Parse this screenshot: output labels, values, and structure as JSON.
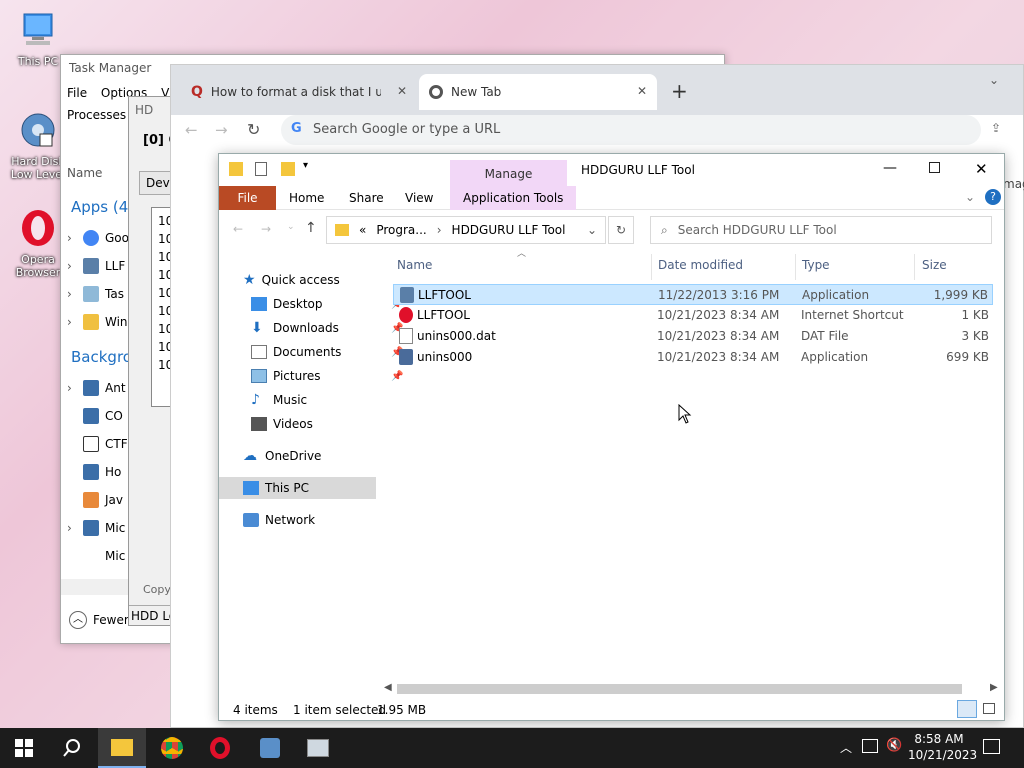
{
  "desktop": {
    "icons": [
      {
        "label": "This PC"
      },
      {
        "label": "Hard Disk Low Level"
      },
      {
        "label": "Opera Browser"
      }
    ]
  },
  "taskmgr": {
    "title": "Task Manager",
    "menu": [
      "File",
      "Options",
      "Vie"
    ],
    "tab": "Processes",
    "column": "Name",
    "apps_group": "Apps (4)",
    "apps": [
      "Goo",
      "LLF",
      "Tas",
      "Win"
    ],
    "bg_group": "Backgro",
    "bg": [
      "Ant",
      "CO",
      "CTF",
      "Ho",
      "Jav",
      "Mic",
      "Mic"
    ],
    "fewer": "Fewer"
  },
  "hddwin": {
    "title": "HD",
    "heading": "[0]  C",
    "dev": "Dev",
    "list": [
      "10",
      "10",
      "10",
      "10",
      "10",
      "10",
      "10",
      "10",
      "10"
    ],
    "copy": "Copy",
    "status": "HDD Lo"
  },
  "chrome": {
    "tabs": [
      {
        "label": "How to format a disk that I usec"
      },
      {
        "label": "New Tab"
      }
    ],
    "omnibox_placeholder": "Search Google or type a URL",
    "side_text": "mag"
  },
  "explorer": {
    "title": "HDDGURU LLF Tool",
    "manage": "Manage",
    "ribbon_tabs": [
      "File",
      "Home",
      "Share",
      "View",
      "Application Tools"
    ],
    "address": {
      "prefix": "«",
      "parts": [
        "Progra...",
        "HDDGURU LLF Tool"
      ]
    },
    "search_placeholder": "Search HDDGURU LLF Tool",
    "nav": {
      "quick_access": "Quick access",
      "items": [
        "Desktop",
        "Downloads",
        "Documents",
        "Pictures",
        "Music",
        "Videos"
      ],
      "onedrive": "OneDrive",
      "thispc": "This PC",
      "network": "Network"
    },
    "columns": [
      "Name",
      "Date modified",
      "Type",
      "Size"
    ],
    "files": [
      {
        "name": "LLFTOOL",
        "date": "11/22/2013 3:16 PM",
        "type": "Application",
        "size": "1,999 KB"
      },
      {
        "name": "LLFTOOL",
        "date": "10/21/2023 8:34 AM",
        "type": "Internet Shortcut",
        "size": "1 KB"
      },
      {
        "name": "unins000.dat",
        "date": "10/21/2023 8:34 AM",
        "type": "DAT File",
        "size": "3 KB"
      },
      {
        "name": "unins000",
        "date": "10/21/2023 8:34 AM",
        "type": "Application",
        "size": "699 KB"
      }
    ],
    "status": {
      "count": "4 items",
      "selected": "1 item selected",
      "size": "1.95 MB"
    }
  },
  "taskbar": {
    "time": "8:58 AM",
    "date": "10/21/2023"
  }
}
